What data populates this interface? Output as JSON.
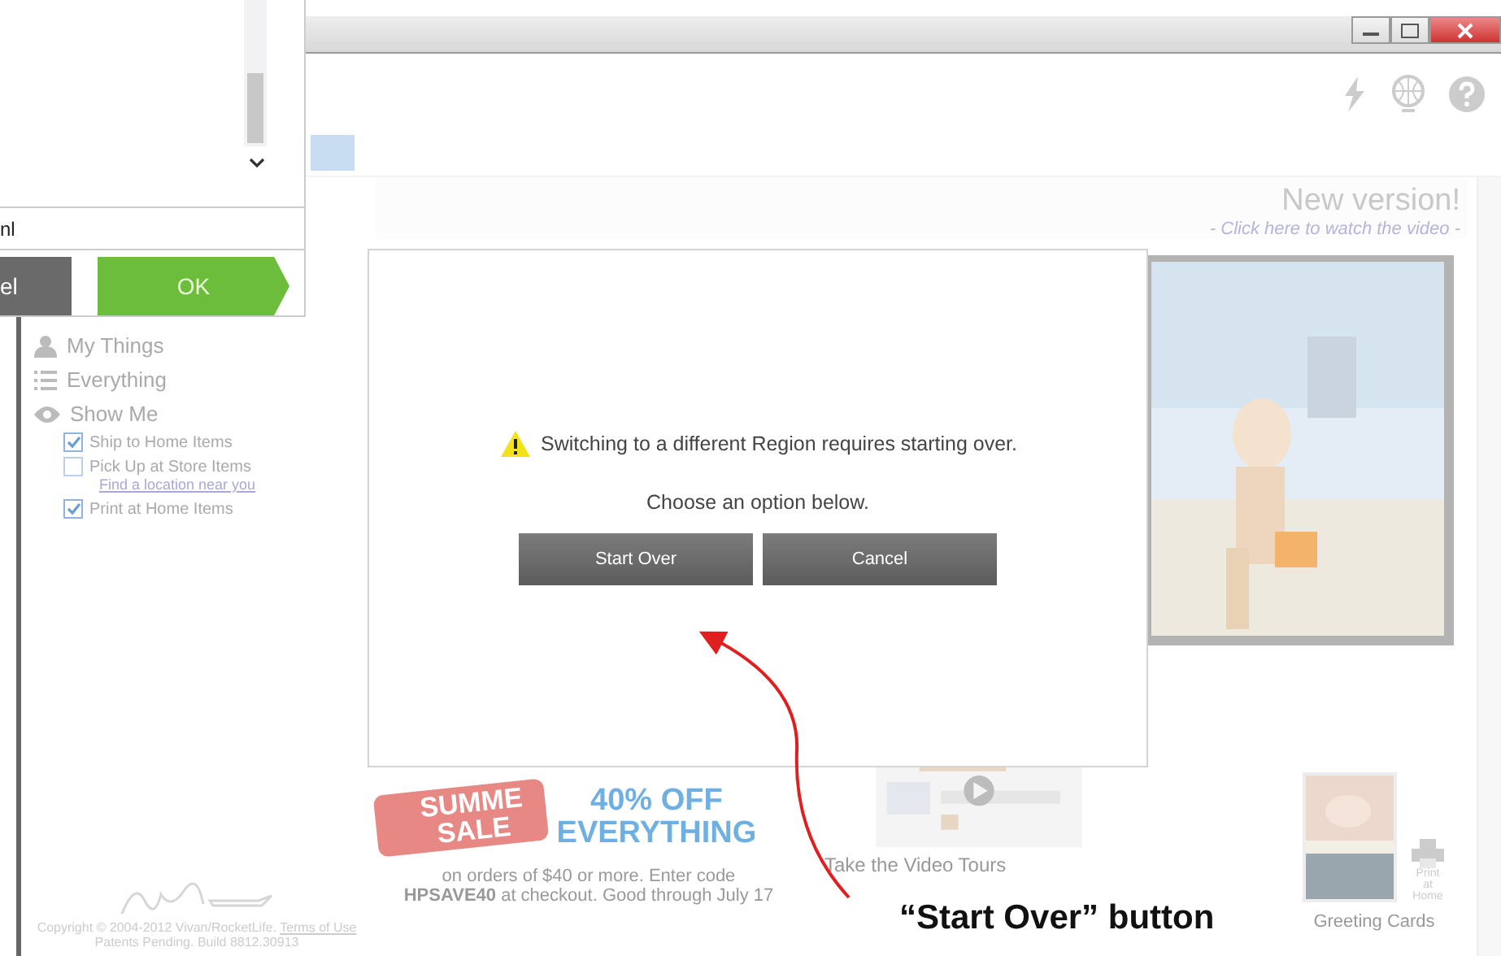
{
  "banner": {
    "title": "New version!",
    "link": "- Click here to watch the video -"
  },
  "sidebar": {
    "items": [
      {
        "label": "My Things",
        "kind": "user"
      },
      {
        "label": "Everything",
        "kind": "list"
      },
      {
        "label": "Show Me",
        "kind": "eye"
      }
    ],
    "filters": [
      {
        "label": "Ship to Home Items",
        "checked": true
      },
      {
        "label": "Pick Up at Store Items",
        "checked": false,
        "link": "Find a location near you"
      },
      {
        "label": "Print at Home Items",
        "checked": true
      }
    ],
    "footer": {
      "copyright": "Copyright © 2004-2012 Vivan/RocketLife.",
      "terms": "Terms of Use",
      "build": "Patents Pending. Build 8812.30913"
    }
  },
  "promo": {
    "badge": [
      "SUMME",
      "SALE"
    ],
    "headline": [
      "40% OFF",
      "EVERYTHING"
    ],
    "text": [
      "on orders of $40 or more.  Enter code",
      "**HPSAVE40** at checkout.  Good through July 17"
    ]
  },
  "video": {
    "title": "Take the Video Tours"
  },
  "cards": {
    "label": "Greeting Cards",
    "print": "Print at Home"
  },
  "panel": {
    "field": "nl",
    "buttons": [
      {
        "label": "el",
        "kind": "secondary"
      },
      {
        "label": "OK",
        "kind": "primary"
      }
    ]
  },
  "dialog": {
    "message": "Switching to a different Region requires starting over.",
    "prompt": "Choose an option below.",
    "buttons": [
      "Start Over",
      "Cancel"
    ]
  },
  "annotation": {
    "text": "“Start Over” button"
  }
}
